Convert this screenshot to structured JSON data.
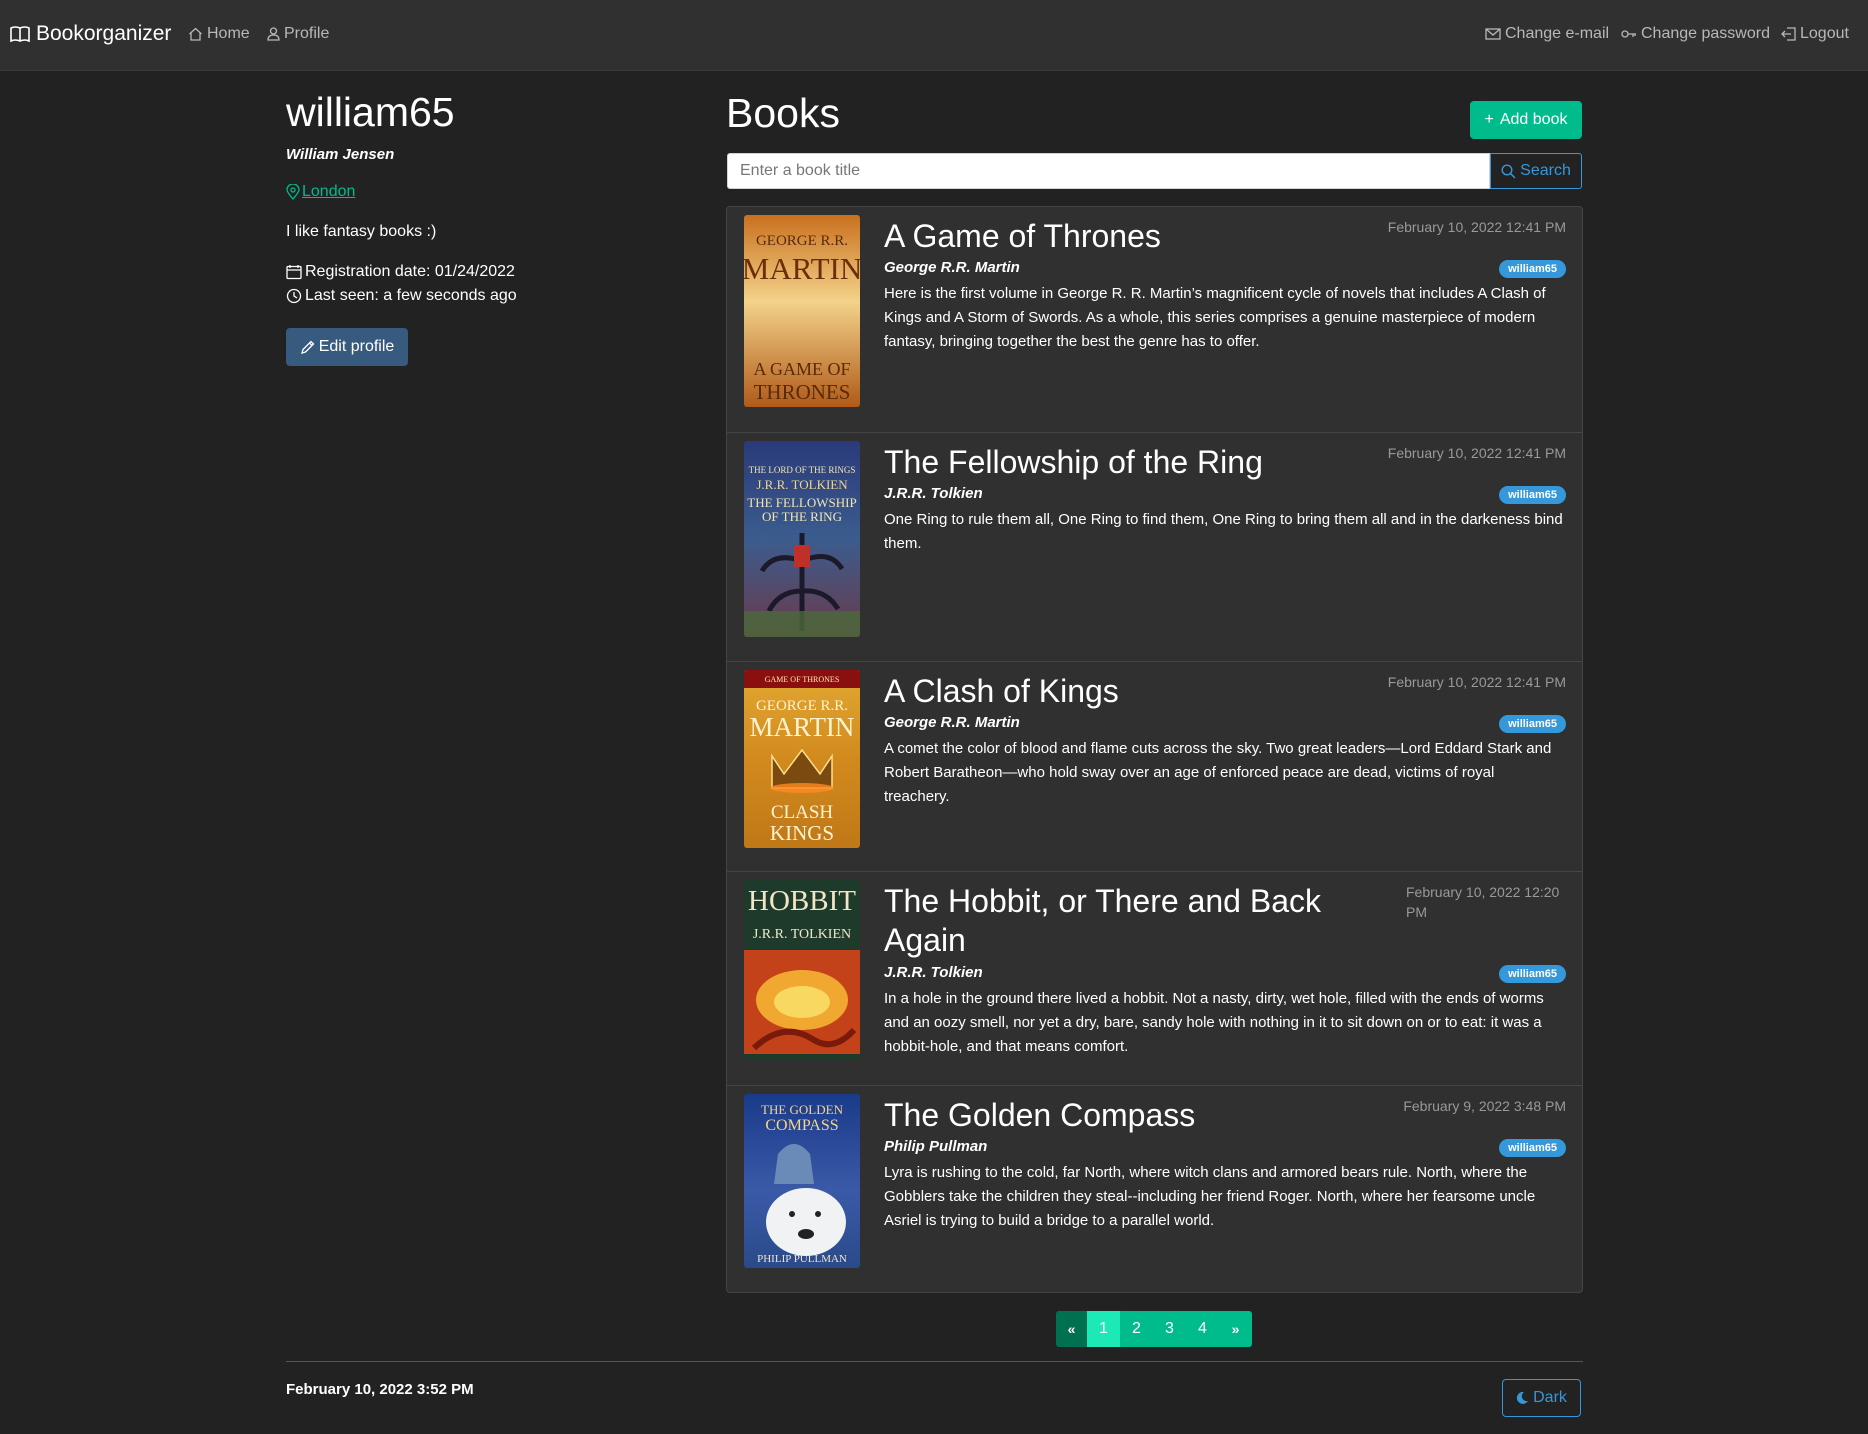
{
  "navbar": {
    "brand": "Bookorganizer",
    "home": "Home",
    "profile": "Profile",
    "change_email": "Change e-mail",
    "change_password": "Change password",
    "logout": "Logout"
  },
  "profile": {
    "username": "william65",
    "full_name": "William Jensen",
    "location": "London",
    "bio": "I like fantasy books :)",
    "registration": "Registration date: 01/24/2022",
    "last_seen": "Last seen: a few seconds ago",
    "edit_label": "Edit profile"
  },
  "books_section": {
    "title": "Books",
    "add_label": "Add book",
    "search_placeholder": "Enter a book title",
    "search_label": "Search"
  },
  "books": [
    {
      "title": "A Game of Thrones",
      "author": "George R.R. Martin",
      "date": "February 10, 2022 12:41 PM",
      "owner": "william65",
      "description": "Here is the first volume in George R. R. Martin’s magnificent cycle of novels that includes A Clash of Kings and A Storm of Swords. As a whole, this series comprises a genuine masterpiece of modern fantasy, bringing together the best the genre has to offer.",
      "cover_text": [
        "GEORGE R.R.",
        "MARTIN",
        "A GAME OF",
        "THRONES"
      ]
    },
    {
      "title": "The Fellowship of the Ring",
      "author": "J.R.R. Tolkien",
      "date": "February 10, 2022 12:41 PM",
      "owner": "william65",
      "description": "One Ring to rule them all, One Ring to find them, One Ring to bring them all and in the darkeness bind them.",
      "cover_text": [
        "THE LORD OF THE RINGS",
        "J.R.R. TOLKIEN",
        "THE FELLOWSHIP",
        "OF THE RING"
      ]
    },
    {
      "title": "A Clash of Kings",
      "author": "George R.R. Martin",
      "date": "February 10, 2022 12:41 PM",
      "owner": "william65",
      "description": "A comet the color of blood and flame cuts across the sky. Two great leaders—Lord Eddard Stark and Robert Baratheon—who hold sway over an age of enforced peace are dead, victims of royal treachery.",
      "cover_text": [
        "GAME OF THRONES",
        "GEORGE R.R.",
        "MARTIN",
        "CLASH",
        "KINGS"
      ]
    },
    {
      "title": "The Hobbit, or There and Back Again",
      "author": "J.R.R. Tolkien",
      "date": "February 10, 2022 12:20 PM",
      "owner": "william65",
      "description": "In a hole in the ground there lived a hobbit. Not a nasty, dirty, wet hole, filled with the ends of worms and an oozy smell, nor yet a dry, bare, sandy hole with nothing in it to sit down on or to eat: it was a hobbit-hole, and that means comfort.",
      "cover_text": [
        "HOBBIT",
        "J.R.R. TOLKIEN"
      ]
    },
    {
      "title": "The Golden Compass",
      "author": "Philip Pullman",
      "date": "February 9, 2022 3:48 PM",
      "owner": "william65",
      "description": "Lyra is rushing to the cold, far North, where witch clans and armored bears rule. North, where the Gobblers take the children they steal--including her friend Roger. North, where her fearsome uncle Asriel is trying to build a bridge to a parallel world.",
      "cover_text": [
        "THE GOLDEN",
        "COMPASS",
        "PHILIP PULLMAN"
      ]
    }
  ],
  "pagination": {
    "prev": "«",
    "pages": [
      "1",
      "2",
      "3",
      "4"
    ],
    "next": "»",
    "active": "1"
  },
  "footer": {
    "date": "February 10, 2022 3:52 PM",
    "theme_label": "Dark"
  },
  "colors": {
    "background": "#222222",
    "navbar": "#303030",
    "success": "#00bc8c",
    "info": "#3498db",
    "primary": "#375a7f"
  }
}
